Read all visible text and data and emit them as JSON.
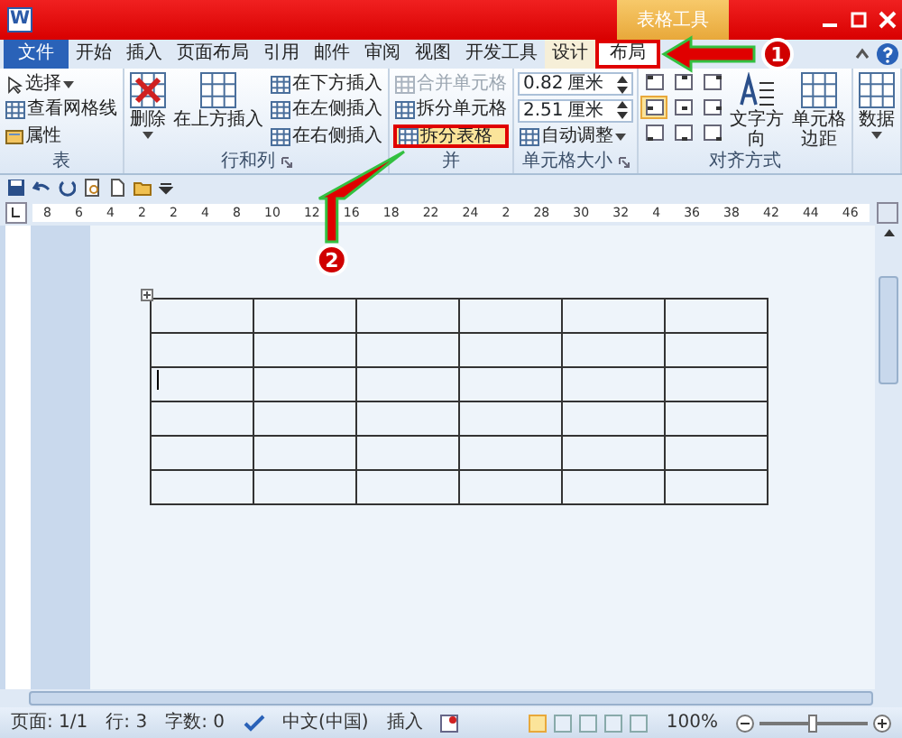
{
  "window": {
    "app_icon": "W",
    "contextual_tab": "表格工具"
  },
  "tabs": [
    {
      "label": "文件",
      "kind": "file",
      "selected": false
    },
    {
      "label": "开始",
      "kind": "normal",
      "selected": false
    },
    {
      "label": "插入",
      "kind": "normal",
      "selected": false
    },
    {
      "label": "页面布局",
      "kind": "normal",
      "selected": false
    },
    {
      "label": "引用",
      "kind": "normal",
      "selected": false
    },
    {
      "label": "邮件",
      "kind": "normal",
      "selected": false
    },
    {
      "label": "审阅",
      "kind": "normal",
      "selected": false
    },
    {
      "label": "视图",
      "kind": "normal",
      "selected": false
    },
    {
      "label": "开发工具",
      "kind": "normal",
      "selected": false
    },
    {
      "label": "设计",
      "kind": "context",
      "selected": false
    },
    {
      "label": "布局",
      "kind": "context",
      "selected": true
    }
  ],
  "ribbon_groups": [
    {
      "label": "表",
      "launcher": false,
      "columns": [
        [
          {
            "kind": "select",
            "label": "选择",
            "dropdown": true,
            "disabled": false,
            "highlighted": false
          },
          {
            "kind": "small",
            "label": "查看网格线",
            "dropdown": false,
            "disabled": false,
            "highlighted": false
          },
          {
            "kind": "props",
            "label": "属性",
            "dropdown": false,
            "disabled": false,
            "highlighted": false
          }
        ]
      ]
    },
    {
      "label": "行和列",
      "launcher": true,
      "columns": [
        [
          {
            "kind": "delete",
            "label": "删除",
            "dropdown": true,
            "disabled": false,
            "highlighted": false
          }
        ],
        [
          {
            "kind": "large",
            "label": "在上方插入",
            "dropdown": false,
            "disabled": false,
            "highlighted": false
          }
        ],
        [
          {
            "kind": "small",
            "label": "在下方插入",
            "dropdown": false,
            "disabled": false,
            "highlighted": false
          },
          {
            "kind": "small",
            "label": "在左侧插入",
            "dropdown": false,
            "disabled": false,
            "highlighted": false
          },
          {
            "kind": "small",
            "label": "在右侧插入",
            "dropdown": false,
            "disabled": false,
            "highlighted": false
          }
        ]
      ]
    },
    {
      "label": "并",
      "launcher": false,
      "columns": [
        [
          {
            "kind": "small",
            "label": "合并单元格",
            "dropdown": false,
            "disabled": true,
            "highlighted": false
          },
          {
            "kind": "small",
            "label": "拆分单元格",
            "dropdown": false,
            "disabled": false,
            "highlighted": false
          },
          {
            "kind": "small",
            "label": "拆分表格",
            "dropdown": false,
            "disabled": false,
            "highlighted": true
          }
        ]
      ]
    },
    {
      "label": "单元格大小",
      "launcher": true,
      "columns": [
        [
          {
            "kind": "spin",
            "value": "0.82",
            "unit": "厘米"
          },
          {
            "kind": "spin",
            "value": "2.51",
            "unit": "厘米"
          },
          {
            "kind": "small",
            "label": "自动调整",
            "dropdown": true,
            "disabled": false,
            "highlighted": false
          }
        ]
      ]
    },
    {
      "label": "对齐方式",
      "launcher": false,
      "columns": [
        [
          {
            "kind": "align",
            "cells": [
              {
                "selected": false
              },
              {
                "selected": false
              },
              {
                "selected": false
              },
              {
                "selected": true
              },
              {
                "selected": false
              },
              {
                "selected": false
              },
              {
                "selected": false
              },
              {
                "selected": false
              },
              {
                "selected": false
              }
            ]
          }
        ],
        [
          {
            "kind": "textdir",
            "label": "文字方向",
            "dropdown": false,
            "disabled": false,
            "highlighted": false
          }
        ],
        [
          {
            "kind": "large",
            "label": "单元格边距",
            "dropdown": false,
            "disabled": false,
            "highlighted": false
          }
        ]
      ]
    },
    {
      "launcher": false,
      "columns": [
        [
          {
            "kind": "large",
            "label": "数据",
            "dropdown": true,
            "disabled": false,
            "highlighted": false
          }
        ]
      ]
    }
  ],
  "ruler_marks": [
    "8",
    "6",
    "4",
    "2",
    "2",
    "4",
    "8",
    "10",
    "12",
    "16",
    "18",
    "22",
    "24",
    "2",
    "28",
    "30",
    "32",
    "4",
    "36",
    "38",
    "42",
    "44",
    "46"
  ],
  "table": {
    "rows": [
      {
        "cells": [
          {
            "cursor": false
          },
          {
            "cursor": false
          },
          {
            "cursor": false
          },
          {
            "cursor": false
          },
          {
            "cursor": false
          },
          {
            "cursor": false
          }
        ]
      },
      {
        "cells": [
          {
            "cursor": false
          },
          {
            "cursor": false
          },
          {
            "cursor": false
          },
          {
            "cursor": false
          },
          {
            "cursor": false
          },
          {
            "cursor": false
          }
        ]
      },
      {
        "cells": [
          {
            "cursor": true
          },
          {
            "cursor": false
          },
          {
            "cursor": false
          },
          {
            "cursor": false
          },
          {
            "cursor": false
          },
          {
            "cursor": false
          }
        ]
      },
      {
        "cells": [
          {
            "cursor": false
          },
          {
            "cursor": false
          },
          {
            "cursor": false
          },
          {
            "cursor": false
          },
          {
            "cursor": false
          },
          {
            "cursor": false
          }
        ]
      },
      {
        "cells": [
          {
            "cursor": false
          },
          {
            "cursor": false
          },
          {
            "cursor": false
          },
          {
            "cursor": false
          },
          {
            "cursor": false
          },
          {
            "cursor": false
          }
        ]
      },
      {
        "cells": [
          {
            "cursor": false
          },
          {
            "cursor": false
          },
          {
            "cursor": false
          },
          {
            "cursor": false
          },
          {
            "cursor": false
          },
          {
            "cursor": false
          }
        ]
      }
    ]
  },
  "status_bar": {
    "page": "页面: 1/1",
    "line": "行: 3",
    "words": "字数: 0",
    "language": "中文(中国)",
    "mode": "插入",
    "views": [
      {
        "selected": true
      },
      {
        "selected": false
      },
      {
        "selected": false
      },
      {
        "selected": false
      },
      {
        "selected": false
      }
    ],
    "zoom": "100%",
    "zoom_slider": {
      "level": 0.5
    }
  },
  "callouts": [
    {
      "number": "1"
    },
    {
      "number": "2"
    }
  ]
}
